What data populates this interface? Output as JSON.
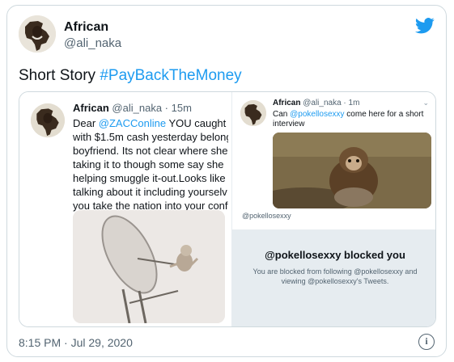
{
  "tweet": {
    "author_name": "African",
    "author_handle": "@ali_naka",
    "text_prefix": "Short Story ",
    "hashtag": "#PayBackTheMoney",
    "timestamp": "8:15 PM · Jul 29, 2020"
  },
  "quoted_tweet": {
    "author_name": "African",
    "author_handle": "@ali_naka",
    "age": "· 15m",
    "lines": [
      {
        "prefix": "Dear ",
        "mention": "@ZACConline",
        "suffix": " YOU caught s"
      },
      {
        "prefix": "with $1.5m cash yesterday belong",
        "mention": "",
        "suffix": ""
      },
      {
        "prefix": "boyfriend. Its not clear where she",
        "mention": "",
        "suffix": ""
      },
      {
        "prefix": "taking it to though some say she",
        "mention": "",
        "suffix": ""
      },
      {
        "prefix": "helping smuggle it-out.Looks like",
        "mention": "",
        "suffix": ""
      },
      {
        "prefix": "talking about it including yourselv",
        "mention": "",
        "suffix": ""
      },
      {
        "prefix": "you take the nation into your conf",
        "mention": "",
        "suffix": ""
      }
    ]
  },
  "screenshot_tweet": {
    "author_name": "African",
    "author_handle": "@ali_naka",
    "age": "· 1m",
    "text_prefix": "Can ",
    "mention": "@pokellosexxy",
    "text_suffix": " come here for a short interview",
    "image_handle": "@pokellosexxy",
    "blocked_title": "@pokellosexxy blocked you",
    "blocked_sub": "You are blocked from following @pokellosexxy and viewing @pokellosexxy's Tweets."
  },
  "icons": {
    "brand": "twitter-bird-icon",
    "info": "info-icon",
    "chevron": "chevron-down-icon"
  },
  "colors": {
    "accent": "#1d9bf0",
    "text": "#0f1419",
    "muted": "#536471",
    "border": "#cfd9de",
    "blocked_bg": "#e6ecf0"
  }
}
